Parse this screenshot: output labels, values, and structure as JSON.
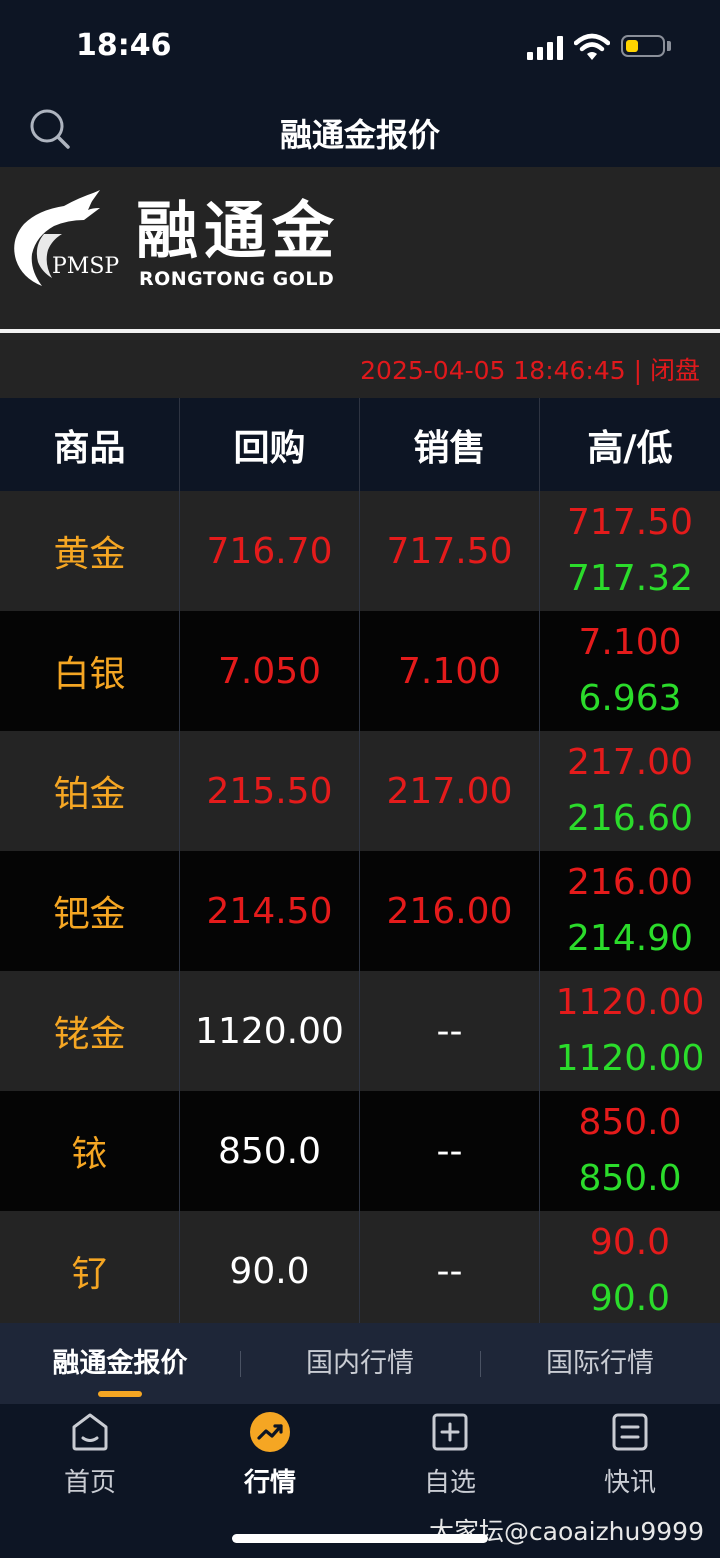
{
  "status": {
    "time": "18:46"
  },
  "nav": {
    "title": "融通金报价"
  },
  "brand": {
    "pmsp": "PMSP",
    "name_cn": "融通金",
    "name_en": "RONGTONG  GOLD"
  },
  "timestamp": "2025-04-05 18:46:45 | 闭盘",
  "table": {
    "headers": [
      "商品",
      "回购",
      "销售",
      "高/低"
    ],
    "rows": [
      {
        "name": "黄金",
        "buy": "716.70",
        "sell": "717.50",
        "high": "717.50",
        "low": "717.32"
      },
      {
        "name": "白银",
        "buy": "7.050",
        "sell": "7.100",
        "high": "7.100",
        "low": "6.963"
      },
      {
        "name": "铂金",
        "buy": "215.50",
        "sell": "217.00",
        "high": "217.00",
        "low": "216.60"
      },
      {
        "name": "钯金",
        "buy": "214.50",
        "sell": "216.00",
        "high": "216.00",
        "low": "214.90"
      },
      {
        "name": "铑金",
        "buy": "1120.00",
        "sell": "--",
        "high": "1120.00",
        "low": "1120.00"
      },
      {
        "name": "铱",
        "buy": "850.0",
        "sell": "--",
        "high": "850.0",
        "low": "850.0"
      },
      {
        "name": "钌",
        "buy": "90.0",
        "sell": "--",
        "high": "90.0",
        "low": "90.0"
      }
    ]
  },
  "subtabs": [
    "融通金报价",
    "国内行情",
    "国际行情"
  ],
  "tabbar": [
    "首页",
    "行情",
    "自选",
    "快讯"
  ],
  "watermark": "大家坛@caoaizhu9999",
  "colors": {
    "accent": "#f5a623",
    "up": "#e41b1b",
    "down": "#2bdc2b",
    "bg": "#0d1524"
  }
}
